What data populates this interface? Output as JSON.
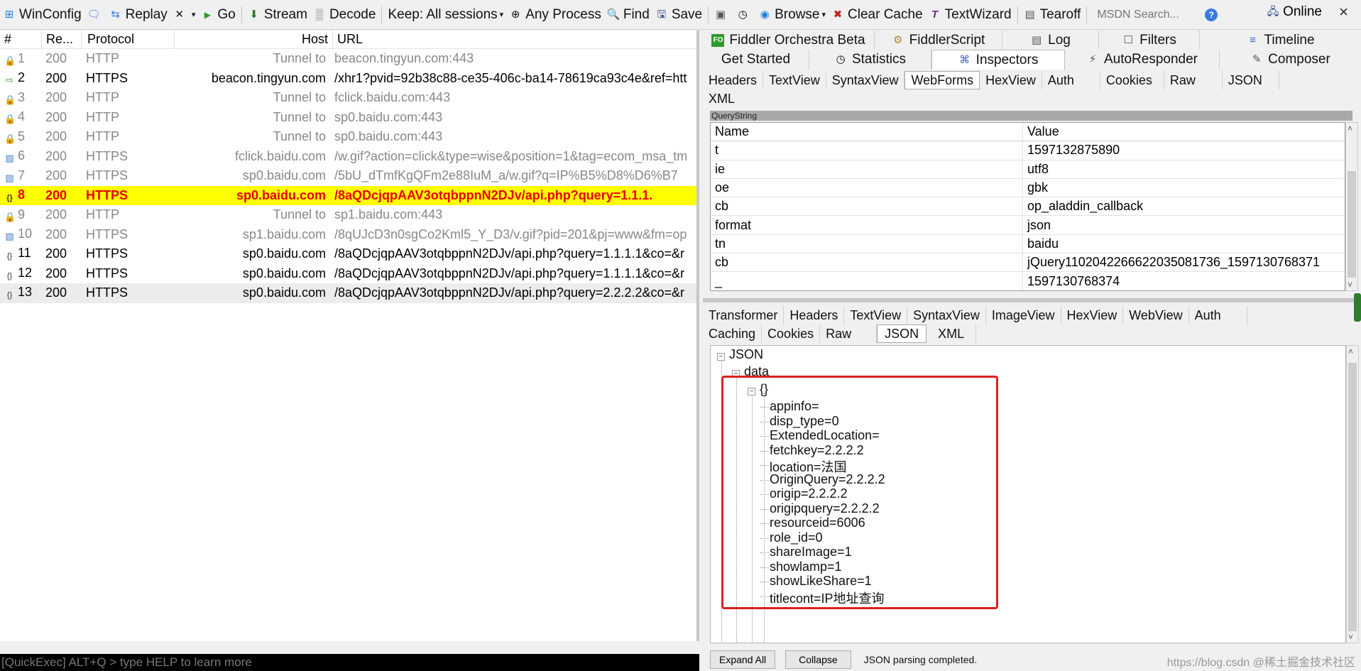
{
  "toolbar": {
    "winconfig": "WinConfig",
    "replay": "Replay",
    "go": "Go",
    "stream": "Stream",
    "decode": "Decode",
    "keep": "Keep: All sessions",
    "process": "Any Process",
    "find": "Find",
    "save": "Save",
    "browse": "Browse",
    "clear_cache": "Clear Cache",
    "textwizard": "TextWizard",
    "tearoff": "Tearoff",
    "msdn_placeholder": "MSDN Search...",
    "online": "Online",
    "close": "×"
  },
  "sessions": {
    "columns": {
      "num": "#",
      "result": "Re...",
      "protocol": "Protocol",
      "host": "Host",
      "url": "URL"
    },
    "rows": [
      {
        "num": "1",
        "result": "200",
        "protocol": "HTTP",
        "host": "Tunnel to",
        "url": "beacon.tingyun.com:443",
        "icon": "lock-icon",
        "style": "tunnel"
      },
      {
        "num": "2",
        "result": "200",
        "protocol": "HTTPS",
        "host": "beacon.tingyun.com",
        "url": "/xhr1?pvid=92b38c88-ce35-406c-ba14-78619ca93c4e&ref=htt",
        "icon": "arrow-icon",
        "style": "normal"
      },
      {
        "num": "3",
        "result": "200",
        "protocol": "HTTP",
        "host": "Tunnel to",
        "url": "fclick.baidu.com:443",
        "icon": "lock-icon",
        "style": "tunnel"
      },
      {
        "num": "4",
        "result": "200",
        "protocol": "HTTP",
        "host": "Tunnel to",
        "url": "sp0.baidu.com:443",
        "icon": "lock-icon",
        "style": "tunnel"
      },
      {
        "num": "5",
        "result": "200",
        "protocol": "HTTP",
        "host": "Tunnel to",
        "url": "sp0.baidu.com:443",
        "icon": "lock-icon",
        "style": "tunnel"
      },
      {
        "num": "6",
        "result": "200",
        "protocol": "HTTPS",
        "host": "fclick.baidu.com",
        "url": "/w.gif?action=click&type=wise&position=1&tag=ecom_msa_tm",
        "icon": "image-icon",
        "style": "tunnel"
      },
      {
        "num": "7",
        "result": "200",
        "protocol": "HTTPS",
        "host": "sp0.baidu.com",
        "url": "/5bU_dTmfKgQFm2e88IuM_a/w.gif?q=IP%B5%D8%D6%B7",
        "icon": "image-icon",
        "style": "tunnel"
      },
      {
        "num": "8",
        "result": "200",
        "protocol": "HTTPS",
        "host": "sp0.baidu.com",
        "url": "/8aQDcjqpAAV3otqbppnN2DJv/api.php?query=1.1.1.",
        "icon": "json-icon",
        "style": "selected"
      },
      {
        "num": "9",
        "result": "200",
        "protocol": "HTTP",
        "host": "Tunnel to",
        "url": "sp1.baidu.com:443",
        "icon": "lock-icon",
        "style": "tunnel"
      },
      {
        "num": "10",
        "result": "200",
        "protocol": "HTTPS",
        "host": "sp1.baidu.com",
        "url": "/8qUJcD3n0sgCo2Kml5_Y_D3/v.gif?pid=201&pj=www&fm=op",
        "icon": "image-icon",
        "style": "tunnel"
      },
      {
        "num": "11",
        "result": "200",
        "protocol": "HTTPS",
        "host": "sp0.baidu.com",
        "url": "/8aQDcjqpAAV3otqbppnN2DJv/api.php?query=1.1.1.1&co=&r",
        "icon": "json-icon",
        "style": "normal"
      },
      {
        "num": "12",
        "result": "200",
        "protocol": "HTTPS",
        "host": "sp0.baidu.com",
        "url": "/8aQDcjqpAAV3otqbppnN2DJv/api.php?query=1.1.1.1&co=&r",
        "icon": "json-icon",
        "style": "normal"
      },
      {
        "num": "13",
        "result": "200",
        "protocol": "HTTPS",
        "host": "sp0.baidu.com",
        "url": "/8aQDcjqpAAV3otqbppnN2DJv/api.php?query=2.2.2.2&co=&r",
        "icon": "json-icon",
        "style": "last"
      }
    ],
    "quickexec": "[QuickExec] ALT+Q > type HELP to learn more"
  },
  "right_tabs": {
    "row1": [
      "Fiddler Orchestra Beta",
      "FiddlerScript",
      "Log",
      "Filters",
      "Timeline"
    ],
    "row2": [
      "Get Started",
      "Statistics",
      "Inspectors",
      "AutoResponder",
      "Composer"
    ],
    "active": "Inspectors"
  },
  "request_tabs": {
    "row1": [
      "Headers",
      "TextView",
      "SyntaxView",
      "WebForms",
      "HexView",
      "Auth",
      "Cookies",
      "Raw",
      "JSON"
    ],
    "row2": [
      "XML"
    ],
    "active": "WebForms"
  },
  "querystring": {
    "label": "QueryString",
    "headers": {
      "name": "Name",
      "value": "Value"
    },
    "rows": [
      {
        "name": "t",
        "value": "1597132875890"
      },
      {
        "name": "ie",
        "value": "utf8"
      },
      {
        "name": "oe",
        "value": "gbk"
      },
      {
        "name": "cb",
        "value": "op_aladdin_callback"
      },
      {
        "name": "format",
        "value": "json"
      },
      {
        "name": "tn",
        "value": "baidu"
      },
      {
        "name": "cb",
        "value": "jQuery110204226662203508173 6_1597130768371"
      },
      {
        "name": "_",
        "value": "1597130768374"
      }
    ]
  },
  "response_tabs": {
    "row1": [
      "Transformer",
      "Headers",
      "TextView",
      "SyntaxView",
      "ImageView",
      "HexView",
      "WebView",
      "Auth"
    ],
    "row2": [
      "Caching",
      "Cookies",
      "Raw",
      "JSON",
      "XML"
    ],
    "active": "JSON"
  },
  "json_tree": {
    "root": "JSON",
    "data": "data",
    "object": "{}",
    "items": [
      "appinfo=",
      "disp_type=0",
      "ExtendedLocation=",
      "fetchkey=2.2.2.2",
      "location=法国",
      "OriginQuery=2.2.2.2",
      "origip=2.2.2.2",
      "origipquery=2.2.2.2",
      "resourceid=6006",
      "role_id=0",
      "shareImage=1",
      "showlamp=1",
      "showLikeShare=1",
      "titlecont=IP地址查询"
    ]
  },
  "bottom": {
    "expand_all": "Expand All",
    "collapse": "Collapse",
    "status": "JSON parsing completed.",
    "watermark": "https://blog.csdn @稀土掘金技术社区"
  },
  "colors": {
    "selected_row_bg": "#ffff00",
    "selected_row_text": "#e80000",
    "highlight_box": "#e02020"
  }
}
